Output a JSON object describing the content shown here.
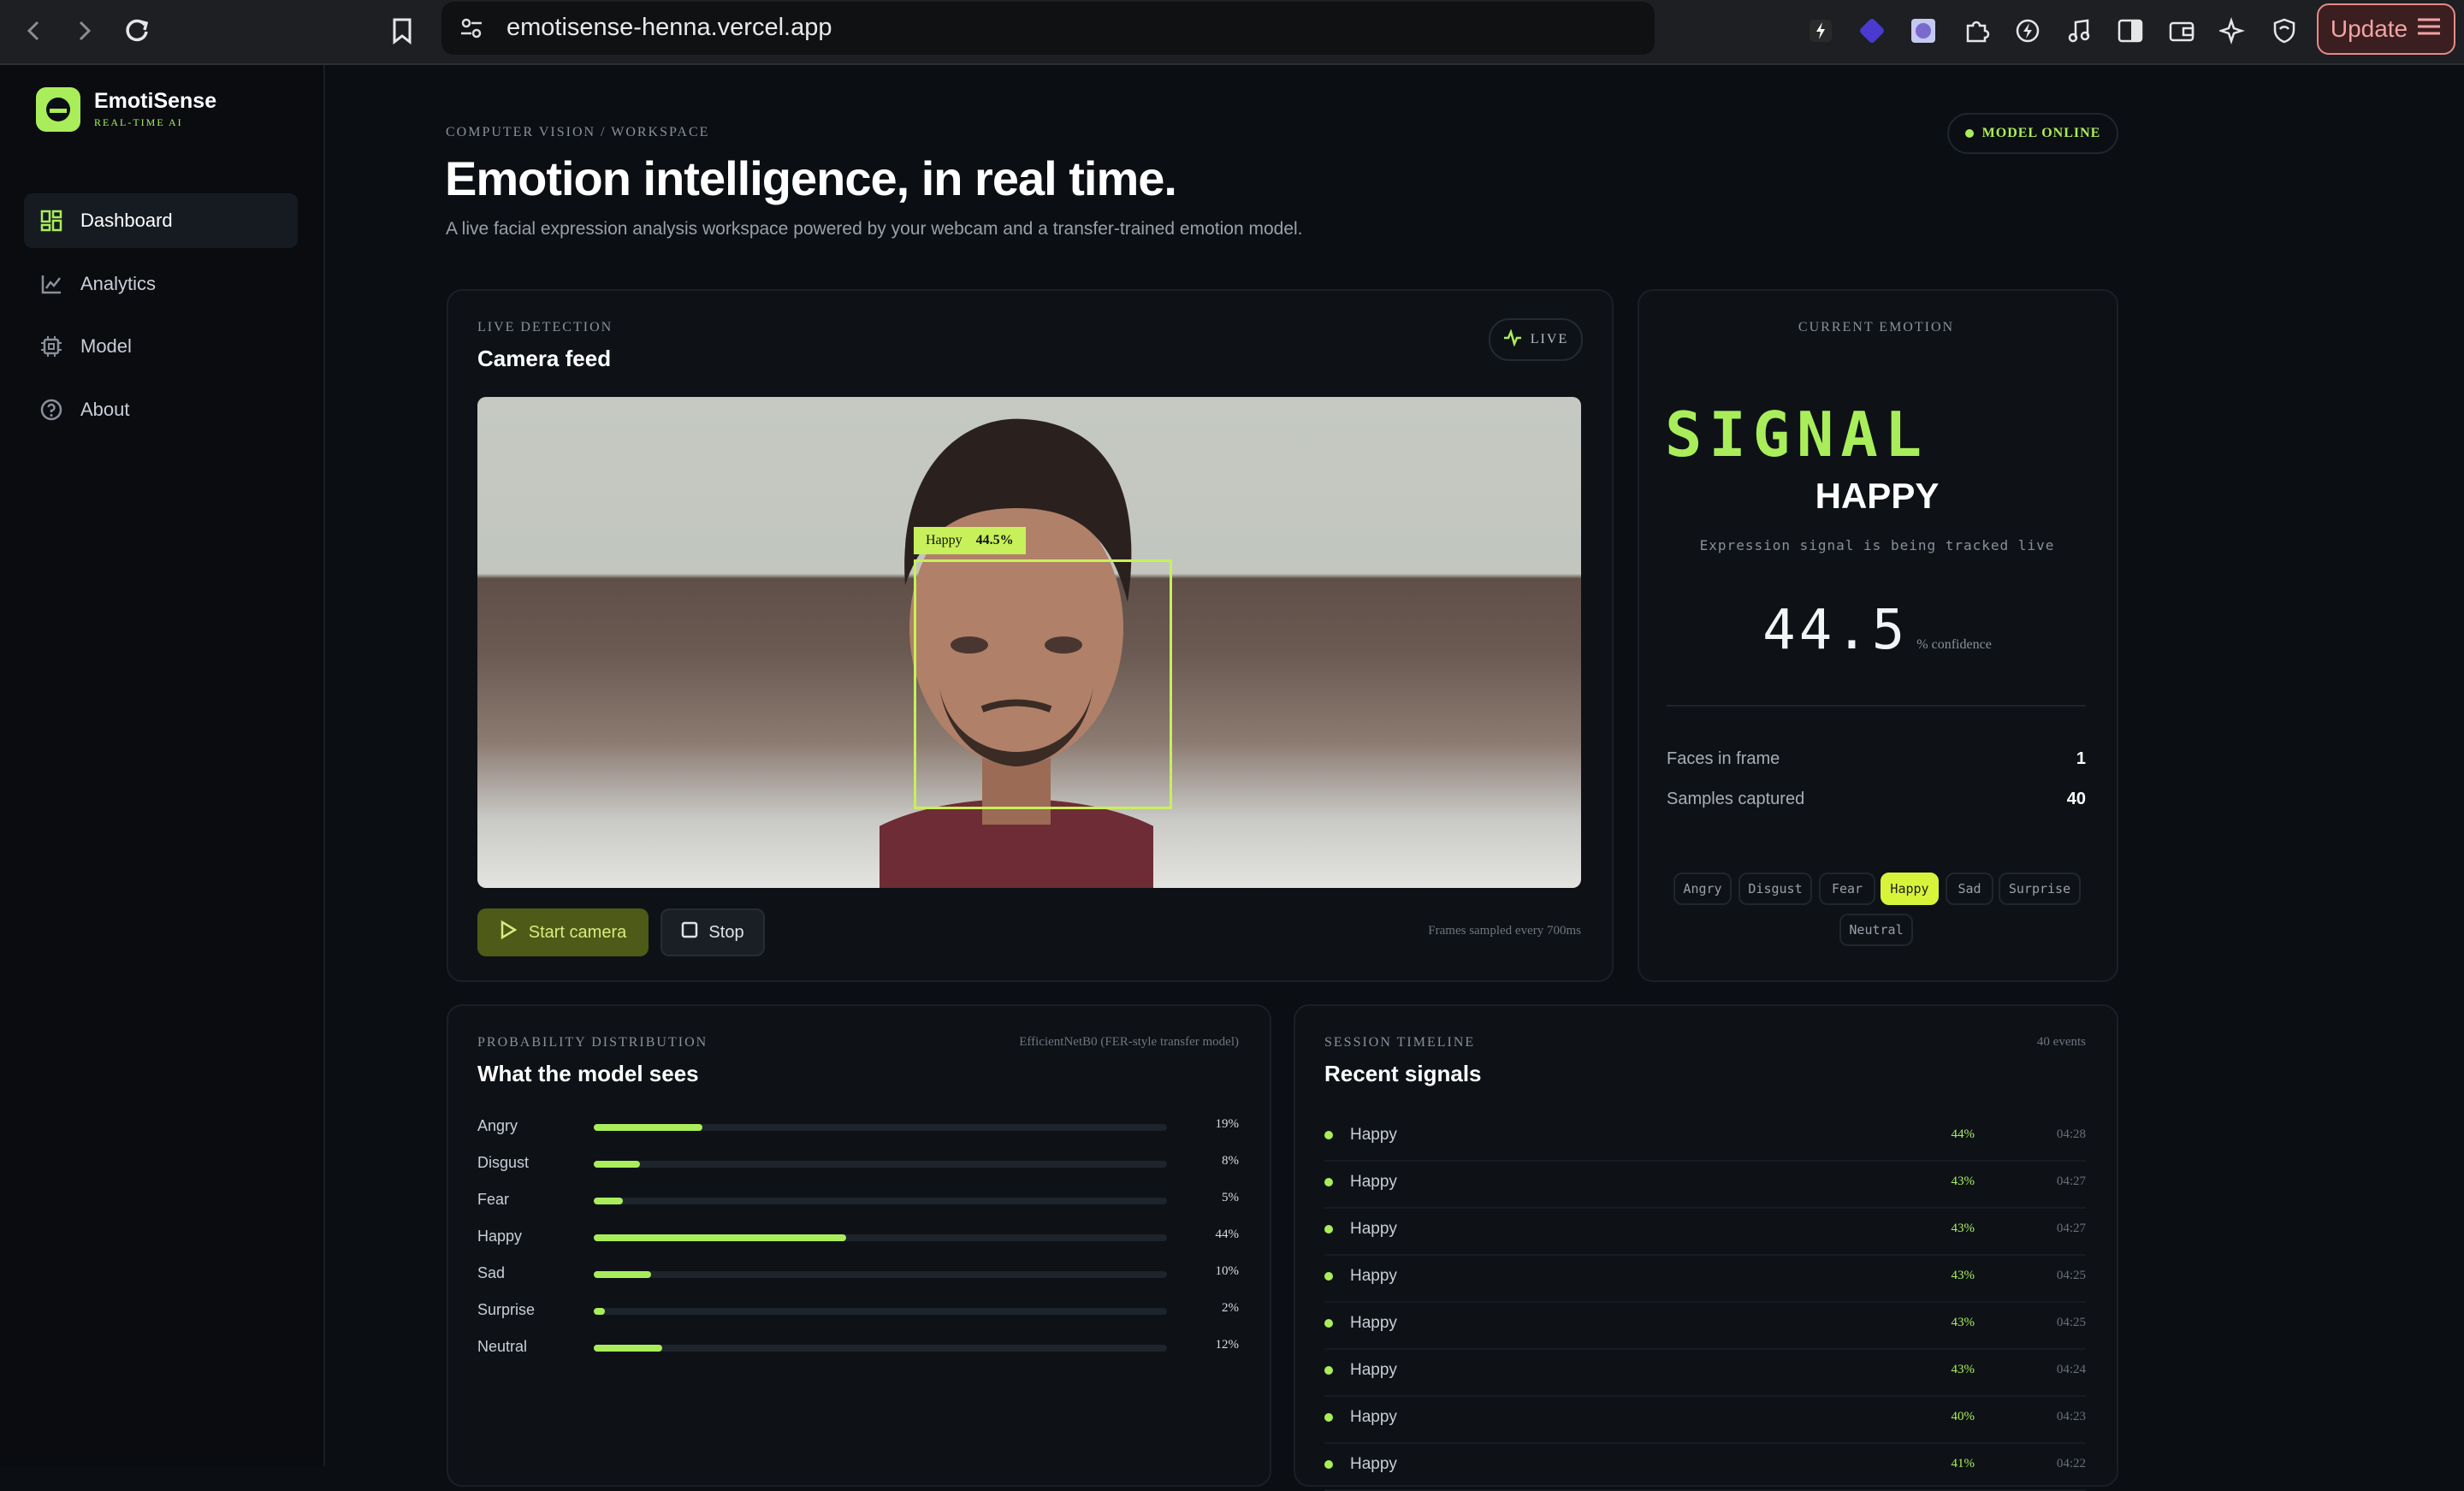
{
  "browser": {
    "url": "emotisense-henna.vercel.app",
    "update_label": "Update"
  },
  "sidebar": {
    "brand": "EmotiSense",
    "tagline": "REAL-TIME AI",
    "items": [
      {
        "label": "Dashboard",
        "icon": "dashboard-icon",
        "active": true
      },
      {
        "label": "Analytics",
        "icon": "chart-line-icon",
        "active": false
      },
      {
        "label": "Model",
        "icon": "chip-icon",
        "active": false
      },
      {
        "label": "About",
        "icon": "help-circle-icon",
        "active": false
      }
    ]
  },
  "header": {
    "breadcrumb": "COMPUTER VISION / WORKSPACE",
    "title": "Emotion intelligence, in real time.",
    "subtitle": "A live facial expression analysis workspace powered by your webcam and a transfer-trained emotion model.",
    "status_badge": "MODEL ONLINE"
  },
  "camera": {
    "eyebrow": "LIVE DETECTION",
    "title": "Camera feed",
    "live_label": "LIVE",
    "detection_label": "Happy",
    "detection_conf": "44.5%",
    "start_label": "Start camera",
    "stop_label": "Stop",
    "frames_note": "Frames sampled every 700ms"
  },
  "current": {
    "eyebrow": "CURRENT EMOTION",
    "signal_word": "SIGNAL",
    "emotion": "HAPPY",
    "description": "Expression signal is being tracked live",
    "confidence": "44.5",
    "confidence_unit": "% confidence",
    "stats": [
      {
        "label": "Faces in frame",
        "value": "1"
      },
      {
        "label": "Samples captured",
        "value": "40"
      }
    ],
    "chips": [
      "Angry",
      "Disgust",
      "Fear",
      "Happy",
      "Sad",
      "Surprise",
      "Neutral"
    ],
    "active_chip": "Happy"
  },
  "distribution": {
    "eyebrow": "PROBABILITY DISTRIBUTION",
    "title": "What the model sees",
    "model_note": "EfficientNetB0 (FER-style transfer model)",
    "rows": [
      {
        "label": "Angry",
        "value": 19,
        "pct": "19%"
      },
      {
        "label": "Disgust",
        "value": 8,
        "pct": "8%"
      },
      {
        "label": "Fear",
        "value": 5,
        "pct": "5%"
      },
      {
        "label": "Happy",
        "value": 44,
        "pct": "44%"
      },
      {
        "label": "Sad",
        "value": 10,
        "pct": "10%"
      },
      {
        "label": "Surprise",
        "value": 2,
        "pct": "2%"
      },
      {
        "label": "Neutral",
        "value": 12,
        "pct": "12%"
      }
    ]
  },
  "timeline": {
    "eyebrow": "SESSION TIMELINE",
    "title": "Recent signals",
    "count": "40 events",
    "events": [
      {
        "label": "Happy",
        "pct": "44%",
        "time": "04:28"
      },
      {
        "label": "Happy",
        "pct": "43%",
        "time": "04:27"
      },
      {
        "label": "Happy",
        "pct": "43%",
        "time": "04:27"
      },
      {
        "label": "Happy",
        "pct": "43%",
        "time": "04:25"
      },
      {
        "label": "Happy",
        "pct": "43%",
        "time": "04:25"
      },
      {
        "label": "Happy",
        "pct": "43%",
        "time": "04:24"
      },
      {
        "label": "Happy",
        "pct": "40%",
        "time": "04:23"
      },
      {
        "label": "Happy",
        "pct": "41%",
        "time": "04:22"
      }
    ]
  },
  "colors": {
    "accent": "#a9ee5a",
    "chip_active": "#d8f43a",
    "background": "#0b0e12"
  }
}
